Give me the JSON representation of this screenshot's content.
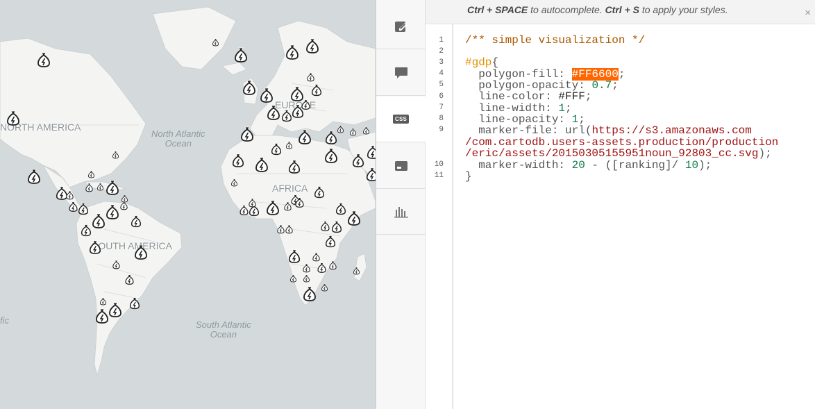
{
  "map": {
    "continents": {
      "north_america": "NORTH AMERICA",
      "europe": "EUROPE",
      "africa": "AFRICA",
      "south_america": "SOUTH AMERICA"
    },
    "oceans": {
      "north_atlantic_line1": "North Atlantic",
      "north_atlantic_line2": "Ocean",
      "south_atlantic_line1": "South Atlantic",
      "south_atlantic_line2": "Ocean",
      "pacific_fragment": "fic"
    },
    "colors": {
      "water": "#d4dadc",
      "land": "#f4f4f2",
      "marker": "#222222"
    },
    "marker_icon": "money-bag-icon"
  },
  "toolbar": {
    "items": [
      {
        "name": "wizard",
        "icon": "pencil-icon"
      },
      {
        "name": "infowindow",
        "icon": "speech-bubble-icon"
      },
      {
        "name": "css",
        "icon": "css-icon",
        "label": "CSS"
      },
      {
        "name": "legend",
        "icon": "legend-icon"
      },
      {
        "name": "widgets",
        "icon": "bar-chart-icon"
      }
    ],
    "active": "css"
  },
  "editor": {
    "hint": {
      "key1": "Ctrl + SPACE",
      "text1": " to autocomplete. ",
      "key2": "Ctrl + S",
      "text2": " to apply your styles."
    },
    "close_glyph": "×",
    "line_numbers": [
      "1",
      "2",
      "3",
      "4",
      "5",
      "6",
      "7",
      "8",
      "9",
      "10",
      "11"
    ],
    "code": {
      "l1": "/** simple visualization */",
      "l3_sel": "#gdp",
      "l3_brace": "{",
      "l4_prop": "  polygon-fill: ",
      "l4_val": "#FF6600",
      "l4_end": ";",
      "l5_prop": "  polygon-opacity: ",
      "l5_val": "0.7",
      "l5_end": ";",
      "l6_prop": "  line-color: ",
      "l6_val": "#FFF",
      "l6_end": ";",
      "l7_prop": "  line-width: ",
      "l7_val": "1",
      "l7_end": ";",
      "l8_prop": "  line-opacity: ",
      "l8_val": "1",
      "l8_end": ";",
      "l9_prop": "  marker-file: url(",
      "l9_url1": "https://s3.amazonaws.com",
      "l9_url2": "/com.cartodb.users-assets.production/production",
      "l9_url3": "/eric/assets/20150305155951noun_92803_cc.svg",
      "l9_end": ");",
      "l10_prop": "  marker-width: ",
      "l10_num": "20",
      "l10_mid": " - ([ranking]/ ",
      "l10_num2": "10",
      "l10_end": ");",
      "l11": "}"
    }
  }
}
